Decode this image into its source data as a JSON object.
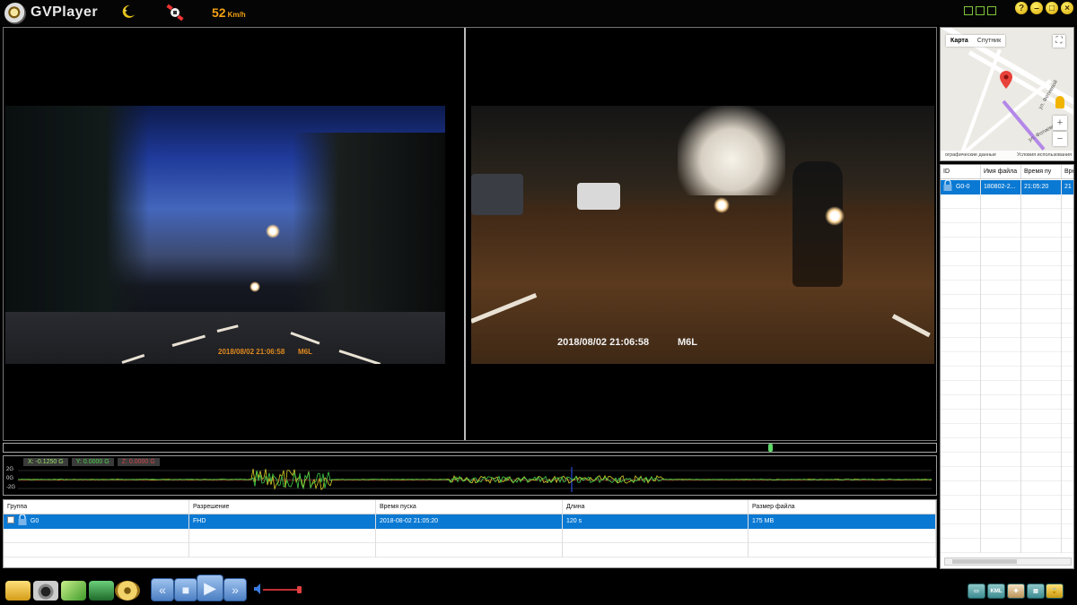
{
  "app": {
    "title": "GVPlayer"
  },
  "speed": {
    "value": "52",
    "unit": "Km/h"
  },
  "window_buttons": [
    "?",
    "–",
    "□",
    "×"
  ],
  "videos": {
    "left": {
      "timestamp": "2018/08/02 21:06:58",
      "model": "M6L"
    },
    "right": {
      "timestamp": "2018/08/02 21:06:58",
      "model": "M6L"
    }
  },
  "playback": {
    "position_fraction": 0.82
  },
  "gsensor": {
    "x": "X: -0.1250 G",
    "y": "Y: 0.0000 G",
    "z": "Z: 0.0000 G",
    "axis_labels": [
      "2G",
      "0G",
      "-2G"
    ]
  },
  "file_table": {
    "headers": [
      "Группа",
      "Разрешение",
      "Время пуска",
      "Длина",
      "Размер файла"
    ],
    "rows": [
      {
        "group": "G0",
        "resolution": "FHD",
        "start_time": "2018-08-02 21:05:20",
        "length": "120 s",
        "size": "175 MB"
      }
    ]
  },
  "map": {
    "tabs": [
      "Карта",
      "Спутник"
    ],
    "footer_left": "ографические данные",
    "footer_right": "Условия использования",
    "street_labels": [
      "ул. Фотиевой",
      "ул. Фотиевой"
    ]
  },
  "side_list": {
    "headers": [
      "ID",
      "Имя файла",
      "Время пу",
      "Вре"
    ],
    "rows": [
      {
        "id": "G0-0",
        "file": "180802-2...",
        "time": "21:05:20",
        "extra": "21"
      }
    ]
  },
  "bottom_right_buttons": [
    "KML"
  ],
  "colors": {
    "accent_speed": "#f2a112",
    "selection": "#0a79d3",
    "frame_border": "#bbbbbb"
  },
  "icons": {
    "left_tools": [
      "folder-icon",
      "camera-icon",
      "money-icon",
      "export-icon",
      "disc-icon"
    ],
    "controls": [
      "rewind-icon",
      "stop-icon",
      "play-icon",
      "fast-forward-icon"
    ],
    "right_tools": [
      "screen-icon",
      "kml-icon",
      "map-icon",
      "settings-icon",
      "lock-icon"
    ]
  }
}
